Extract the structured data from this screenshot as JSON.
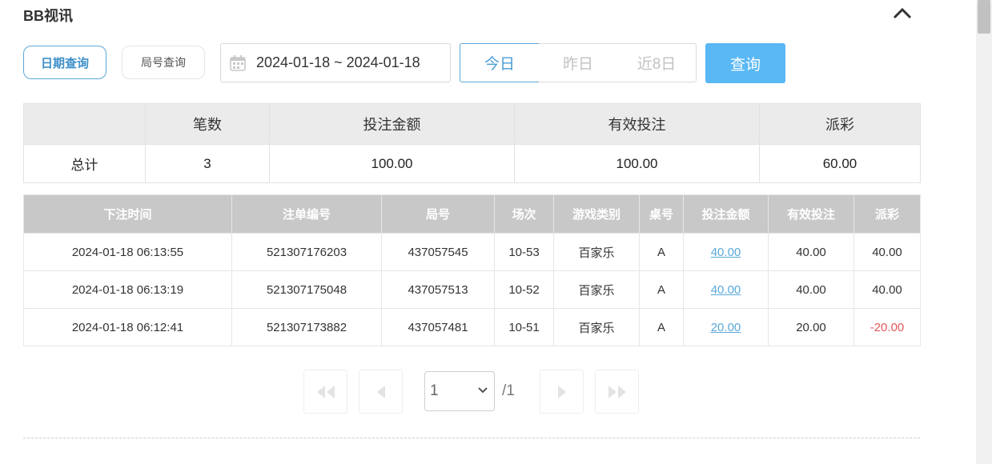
{
  "title": "BB视讯",
  "filters": {
    "mode_date": "日期查询",
    "mode_round": "局号查询",
    "date_range": "2024-01-18 ~ 2024-01-18",
    "quick": [
      "今日",
      "昨日",
      "近8日"
    ],
    "query": "查询"
  },
  "summary": {
    "headers": [
      "",
      "笔数",
      "投注金额",
      "有效投注",
      "派彩"
    ],
    "row": [
      "总计",
      "3",
      "100.00",
      "100.00",
      "60.00"
    ]
  },
  "detail": {
    "headers": [
      "下注时间",
      "注单编号",
      "局号",
      "场次",
      "游戏类别",
      "桌号",
      "投注金额",
      "有效投注",
      "派彩"
    ],
    "rows": [
      [
        "2024-01-18 06:13:55",
        "521307176203",
        "437057545",
        "10-53",
        "百家乐",
        "A",
        "40.00",
        "40.00",
        "40.00"
      ],
      [
        "2024-01-18 06:13:19",
        "521307175048",
        "437057513",
        "10-52",
        "百家乐",
        "A",
        "40.00",
        "40.00",
        "40.00"
      ],
      [
        "2024-01-18 06:12:41",
        "521307173882",
        "437057481",
        "10-51",
        "百家乐",
        "A",
        "20.00",
        "20.00",
        "-20.00"
      ]
    ]
  },
  "pagination": {
    "current": "1",
    "total": "/1"
  },
  "colors": {
    "accent": "#5aa9d9",
    "query_button": "#5ab8f5",
    "negative": "#e05a5a"
  }
}
